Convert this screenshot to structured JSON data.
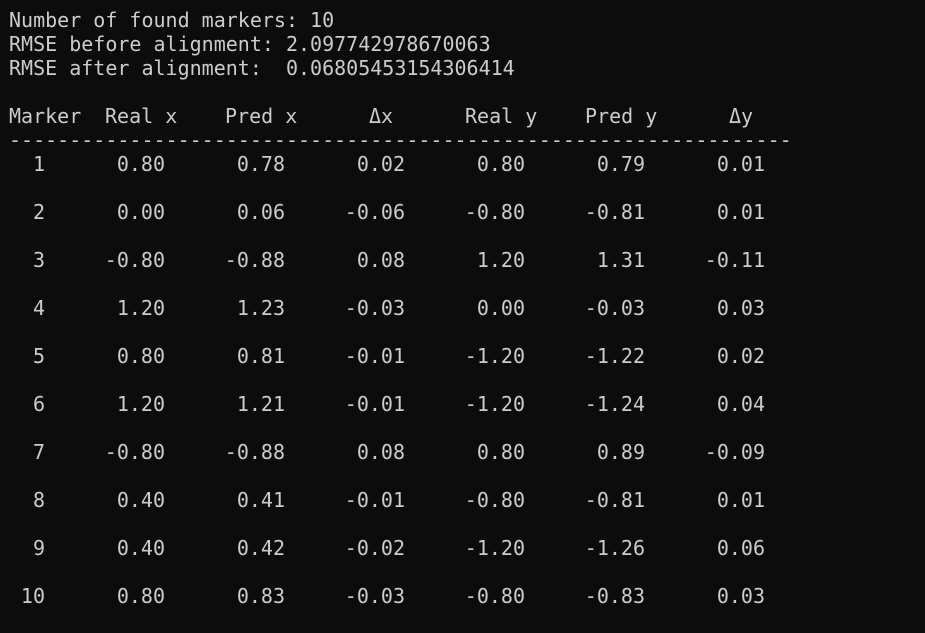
{
  "summary": {
    "found_line": "Number of found markers: 10",
    "rmse_before_line": "RMSE before alignment: 2.097742978670063",
    "rmse_after_line": "RMSE after alignment:  0.06805453154306414"
  },
  "table": {
    "headers": [
      "Marker",
      "Real x",
      "Pred x",
      "Δx",
      "Real y",
      "Pred y",
      "Δy"
    ],
    "rule": "--------------------------------------------------------------------------------------------------",
    "rows": [
      [
        "1",
        "0.80",
        "0.78",
        "0.02",
        "0.80",
        "0.79",
        "0.01"
      ],
      [
        "2",
        "0.00",
        "0.06",
        "-0.06",
        "-0.80",
        "-0.81",
        "0.01"
      ],
      [
        "3",
        "-0.80",
        "-0.88",
        "0.08",
        "1.20",
        "1.31",
        "-0.11"
      ],
      [
        "4",
        "1.20",
        "1.23",
        "-0.03",
        "0.00",
        "-0.03",
        "0.03"
      ],
      [
        "5",
        "0.80",
        "0.81",
        "-0.01",
        "-1.20",
        "-1.22",
        "0.02"
      ],
      [
        "6",
        "1.20",
        "1.21",
        "-0.01",
        "-1.20",
        "-1.24",
        "0.04"
      ],
      [
        "7",
        "-0.80",
        "-0.88",
        "0.08",
        "0.80",
        "0.89",
        "-0.09"
      ],
      [
        "8",
        "0.40",
        "0.41",
        "-0.01",
        "-0.80",
        "-0.81",
        "0.01"
      ],
      [
        "9",
        "0.40",
        "0.42",
        "-0.02",
        "-1.20",
        "-1.26",
        "0.06"
      ],
      [
        "10",
        "0.80",
        "0.83",
        "-0.03",
        "-0.80",
        "-0.83",
        "0.03"
      ]
    ]
  },
  "colors": {
    "background": "#0c0c0c",
    "text": "#cccccc"
  }
}
